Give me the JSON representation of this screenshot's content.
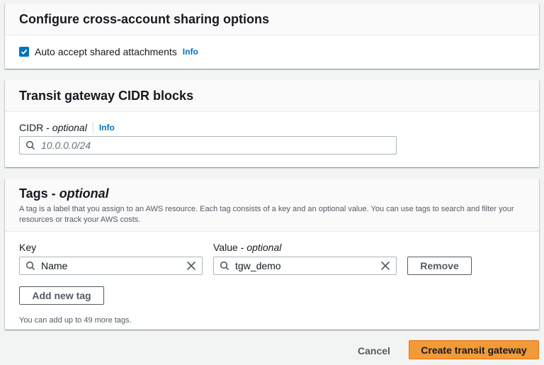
{
  "sharing": {
    "title": "Configure cross-account sharing options",
    "auto_accept": {
      "label": "Auto accept shared attachments",
      "checked": true,
      "info": "Info"
    }
  },
  "cidr": {
    "title": "Transit gateway CIDR blocks",
    "field_label": "CIDR -",
    "field_optional": "optional",
    "info": "Info",
    "placeholder": "10.0.0.0/24",
    "value": ""
  },
  "tags": {
    "title": "Tags -",
    "title_optional": "optional",
    "description": "A tag is a label that you assign to an AWS resource. Each tag consists of a key and an optional value. You can use tags to search and filter your resources or track your AWS costs.",
    "key_label": "Key",
    "value_label": "Value -",
    "value_optional": "optional",
    "rows": [
      {
        "key": "Name",
        "value": "tgw_demo"
      }
    ],
    "remove_label": "Remove",
    "add_label": "Add new tag",
    "hint": "You can add up to 49 more tags."
  },
  "footer": {
    "cancel_label": "Cancel",
    "create_label": "Create transit gateway"
  },
  "colors": {
    "accent": "#0073bb",
    "primary_button": "#f29a38",
    "background": "#f2f3f3"
  }
}
